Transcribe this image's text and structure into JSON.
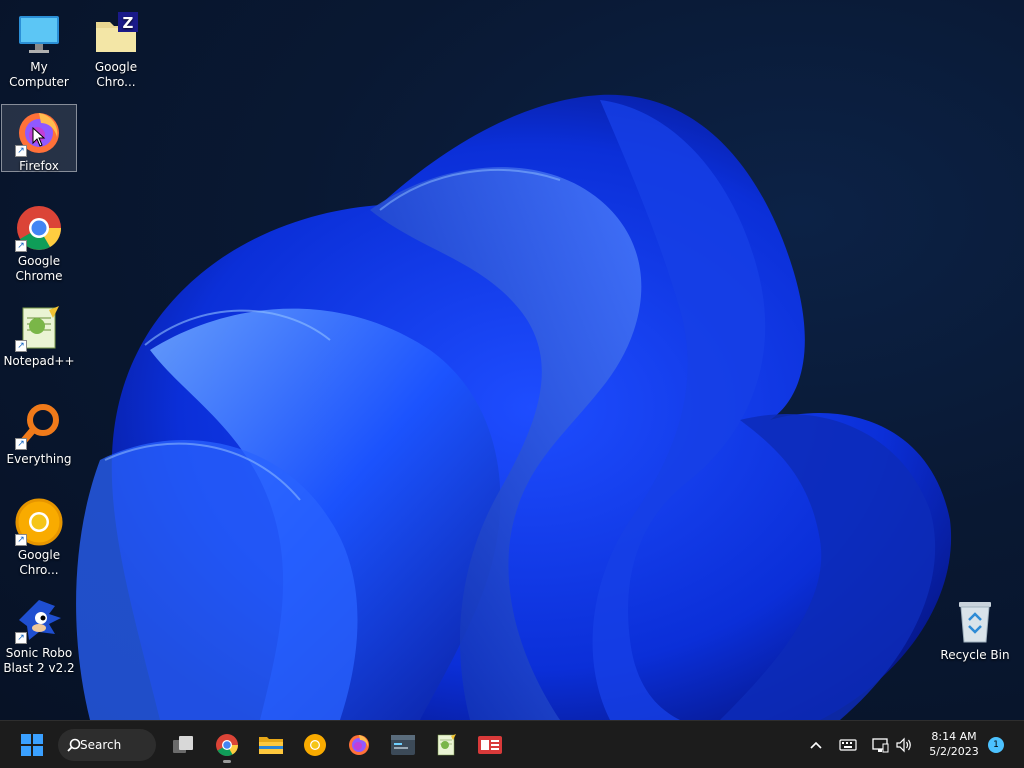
{
  "desktop": {
    "icons": [
      {
        "id": "my-computer",
        "label": "My Computer",
        "icon": "monitor-icon",
        "shortcut": false
      },
      {
        "id": "google-chro-zip",
        "label": "Google\nChro...",
        "icon": "zip-folder-icon",
        "shortcut": false
      },
      {
        "id": "firefox",
        "label": "Firefox",
        "icon": "firefox-icon",
        "shortcut": true,
        "selected": true
      },
      {
        "id": "google-chrome",
        "label": "Google\nChrome",
        "icon": "chrome-icon",
        "shortcut": true
      },
      {
        "id": "notepadpp",
        "label": "Notepad++",
        "icon": "notepadpp-icon",
        "shortcut": true
      },
      {
        "id": "everything",
        "label": "Everything",
        "icon": "everything-search-icon",
        "shortcut": true
      },
      {
        "id": "google-chro-canary",
        "label": "Google\nChro...",
        "icon": "chrome-canary-icon",
        "shortcut": true
      },
      {
        "id": "sonic",
        "label": "Sonic Robo\nBlast 2 v2.2",
        "icon": "sonic-icon",
        "shortcut": true
      },
      {
        "id": "recycle-bin",
        "label": "Recycle Bin",
        "icon": "recycle-bin-icon",
        "shortcut": false
      }
    ]
  },
  "taskbar": {
    "search_label": "Search",
    "pinned": [
      {
        "id": "task-view",
        "icon": "task-view-icon"
      },
      {
        "id": "chrome",
        "icon": "chrome-icon",
        "active": true
      },
      {
        "id": "file-explorer",
        "icon": "folder-icon"
      },
      {
        "id": "chrome-canary",
        "icon": "chrome-canary-icon"
      },
      {
        "id": "firefox",
        "icon": "firefox-icon"
      },
      {
        "id": "terminal",
        "icon": "terminal-icon"
      },
      {
        "id": "notepadpp",
        "icon": "notepadpp-icon"
      },
      {
        "id": "news",
        "icon": "news-icon"
      }
    ],
    "tray": {
      "time": "8:14 AM",
      "date": "5/2/2023",
      "notification_count": "1"
    }
  },
  "colors": {
    "accent": "#0a5cff",
    "taskbar_bg": "#1c1c1c",
    "badge": "#4cc2ff"
  }
}
